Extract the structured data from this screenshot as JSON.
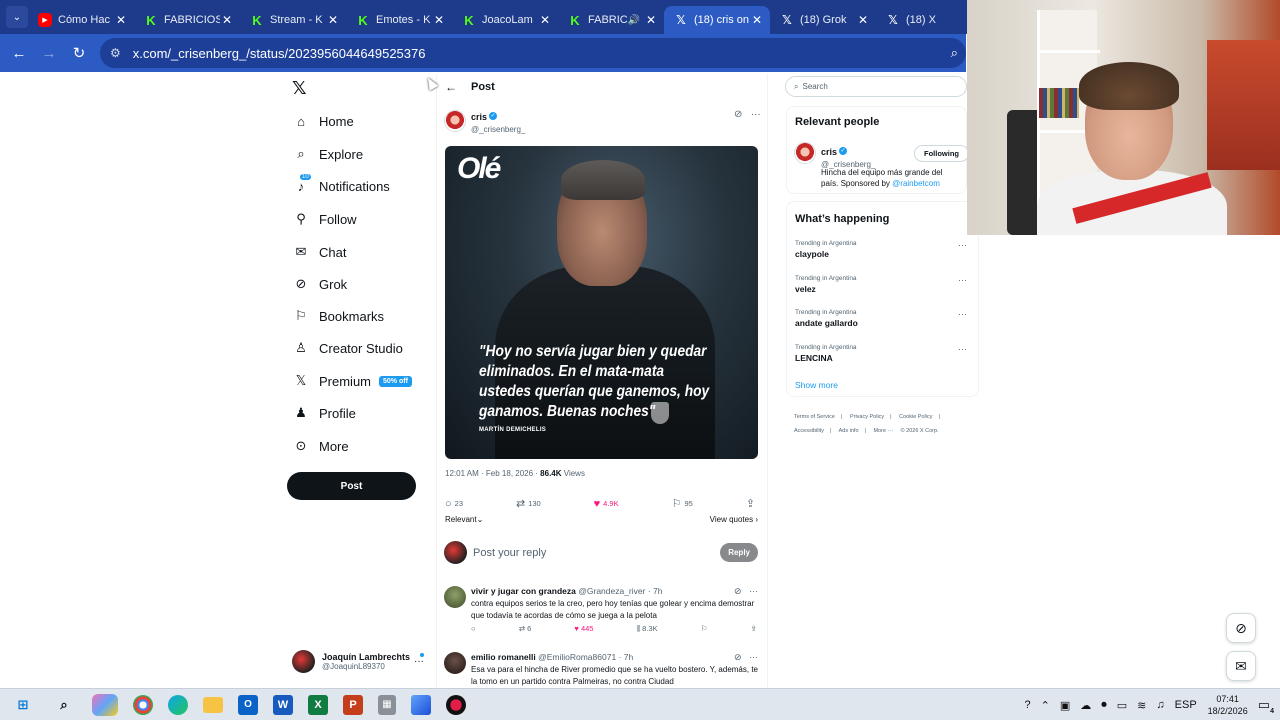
{
  "browser": {
    "tabs": [
      {
        "label": "Cómo Hac",
        "icon": "youtube-icon"
      },
      {
        "label": "FABRICIOS",
        "icon": "kick-icon"
      },
      {
        "label": "Stream - K",
        "icon": "kick-icon"
      },
      {
        "label": "Emotes - K",
        "icon": "kick-icon"
      },
      {
        "label": "JoacoLam",
        "icon": "kick-icon"
      },
      {
        "label": "FABRIC",
        "icon": "kick-icon"
      },
      {
        "label": "(18) cris on",
        "icon": "x-icon"
      },
      {
        "label": "(18) Grok",
        "icon": "x-icon"
      },
      {
        "label": "(18) X",
        "icon": "x-icon"
      }
    ],
    "url": "x.com/_crisenberg_/status/2023956044649525376"
  },
  "sidebar": {
    "items": [
      {
        "label": "Home",
        "icon": "home-icon"
      },
      {
        "label": "Explore",
        "icon": "search-icon"
      },
      {
        "label": "Notifications",
        "icon": "bell-icon",
        "badge": "10"
      },
      {
        "label": "Follow",
        "icon": "follow-icon"
      },
      {
        "label": "Chat",
        "icon": "mail-icon"
      },
      {
        "label": "Grok",
        "icon": "grok-icon"
      },
      {
        "label": "Bookmarks",
        "icon": "bookmark-icon"
      },
      {
        "label": "Creator Studio",
        "icon": "creator-icon"
      },
      {
        "label": "Premium",
        "icon": "x-icon",
        "badge": "50% off"
      },
      {
        "label": "Profile",
        "icon": "profile-icon"
      },
      {
        "label": "More",
        "icon": "more-icon"
      }
    ],
    "post_label": "Post",
    "account": {
      "name": "Joaquín Lambrechts",
      "handle": "@JoaquinL89370"
    }
  },
  "post": {
    "header_title": "Post",
    "author_name": "cris",
    "author_handle": "@_crisenberg_",
    "image_logo": "Olé",
    "image_quote": "\"Hoy no servía jugar bien y quedar eliminados. En el mata-mata ustedes querían que ganemos, hoy ganamos. Buenas noches\"",
    "image_quote_author": "MARTÍN DEMICHELIS",
    "timestamp": "12:01 AM · Feb 18, 2026 · ",
    "views_count": "86.4K",
    "views_label": " Views",
    "stats": {
      "replies": "23",
      "reposts": "130",
      "likes": "4.9K",
      "bookmarks": "95"
    },
    "sort_label": "Relevant",
    "view_quotes": "View quotes",
    "reply_placeholder": "Post your reply",
    "reply_button": "Reply"
  },
  "replies": [
    {
      "name": "vivir y jugar con grandeza",
      "handle": "@Grandeza_river · 7h",
      "text": "contra equipos serios te la creo, pero hoy tenías que golear y encima demostrar que todavía te acordas de cómo se juega a la pelota",
      "reposts": "6",
      "likes": "445",
      "views": "8.3K"
    },
    {
      "name": "emilio romanelli",
      "handle": "@EmilioRoma86071 · 7h",
      "text": "Esa va para el hincha de River promedio que se ha vuelto bostero. Y, además, te la tomo en un partido contra Palmeiras, no contra Ciudad"
    }
  ],
  "right": {
    "search_placeholder": "Search",
    "relevant_title": "Relevant people",
    "person": {
      "name": "cris",
      "handle": "@_crisenberg_",
      "button": "Following",
      "bio": "Hincha del equipo más grande del país. Sponsored by ",
      "bio_link": "@rainbetcom"
    },
    "happening_title": "What’s happening",
    "trends": [
      {
        "category": "Trending in Argentina",
        "name": "claypole"
      },
      {
        "category": "Trending in Argentina",
        "name": "velez"
      },
      {
        "category": "Trending in Argentina",
        "name": "andate gallardo"
      },
      {
        "category": "Trending in Argentina",
        "name": "LENCINA"
      }
    ],
    "show_more": "Show more",
    "footer": [
      "Terms of Service",
      "|",
      "Privacy Policy",
      "|",
      "Cookie Policy",
      "|",
      "Accessibility",
      "|",
      "Ads info",
      "|",
      "More ···",
      "© 2026 X Corp."
    ]
  },
  "taskbar": {
    "language": "ESP",
    "time": "07:41",
    "date": "18/2/2026",
    "notifications": "4"
  },
  "colors": {
    "accent": "#1d9bf0",
    "like": "#f91880",
    "chrome": "#1e3a8a"
  }
}
